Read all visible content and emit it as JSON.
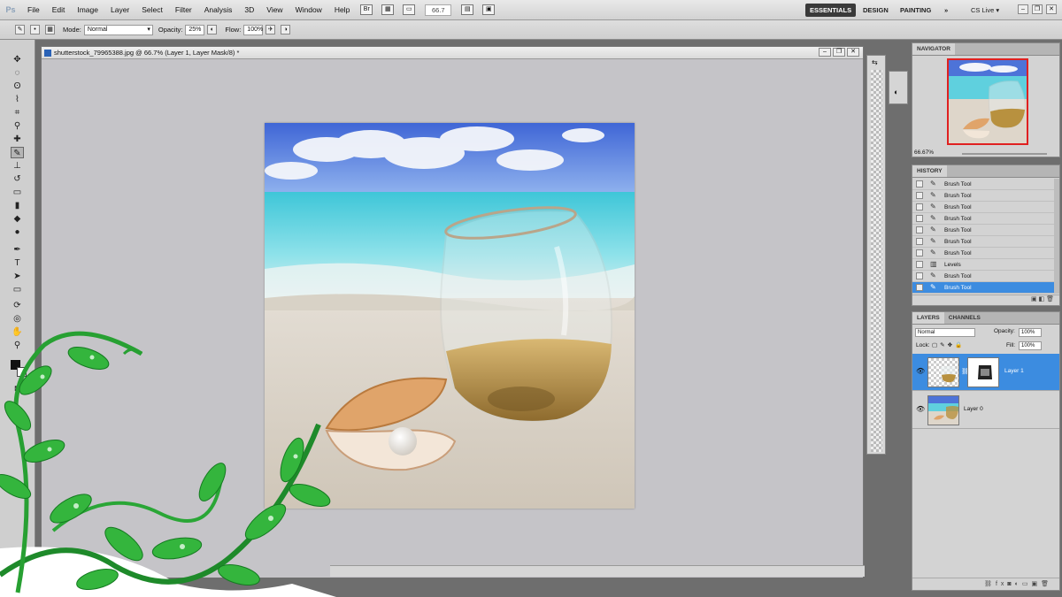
{
  "app": {
    "logo": "Ps"
  },
  "menu": [
    "File",
    "Edit",
    "Image",
    "Layer",
    "Select",
    "Filter",
    "Analysis",
    "3D",
    "View",
    "Window",
    "Help"
  ],
  "menubar_zoom": "66.7",
  "workspaces": {
    "essentials": "ESSENTIALS",
    "design": "DESIGN",
    "painting": "PAINTING",
    "more": "»",
    "cs_live": "CS Live ▾"
  },
  "options": {
    "mode_label": "Mode:",
    "mode_value": "Normal",
    "opacity_label": "Opacity:",
    "opacity_value": "25%",
    "flow_label": "Flow:",
    "flow_value": "100%"
  },
  "document": {
    "title": "shutterstock_79965388.jpg @ 66.7% (Layer 1, Layer Mask/8) *"
  },
  "navigator": {
    "tab": "NAVIGATOR",
    "zoom": "66.67%"
  },
  "history": {
    "tab": "HISTORY",
    "items": [
      {
        "label": "Brush Tool",
        "icon": "brush-icon"
      },
      {
        "label": "Brush Tool",
        "icon": "brush-icon"
      },
      {
        "label": "Brush Tool",
        "icon": "brush-icon"
      },
      {
        "label": "Brush Tool",
        "icon": "brush-icon"
      },
      {
        "label": "Brush Tool",
        "icon": "brush-icon"
      },
      {
        "label": "Brush Tool",
        "icon": "brush-icon"
      },
      {
        "label": "Brush Tool",
        "icon": "brush-icon"
      },
      {
        "label": "Levels",
        "icon": "levels-icon"
      },
      {
        "label": "Brush Tool",
        "icon": "brush-icon"
      },
      {
        "label": "Brush Tool",
        "icon": "brush-icon",
        "selected": true
      }
    ]
  },
  "layers": {
    "tabs": [
      "LAYERS",
      "CHANNELS"
    ],
    "blend_mode": "Normal",
    "opacity_label": "Opacity:",
    "opacity_value": "100%",
    "lock_label": "Lock:",
    "fill_label": "Fill:",
    "fill_value": "100%",
    "items": [
      {
        "name": "Layer 1",
        "selected": true
      },
      {
        "name": "Layer 0",
        "selected": false
      }
    ]
  },
  "colors": {
    "accent": "#3c8ce0",
    "nav_frame": "#e02020"
  }
}
